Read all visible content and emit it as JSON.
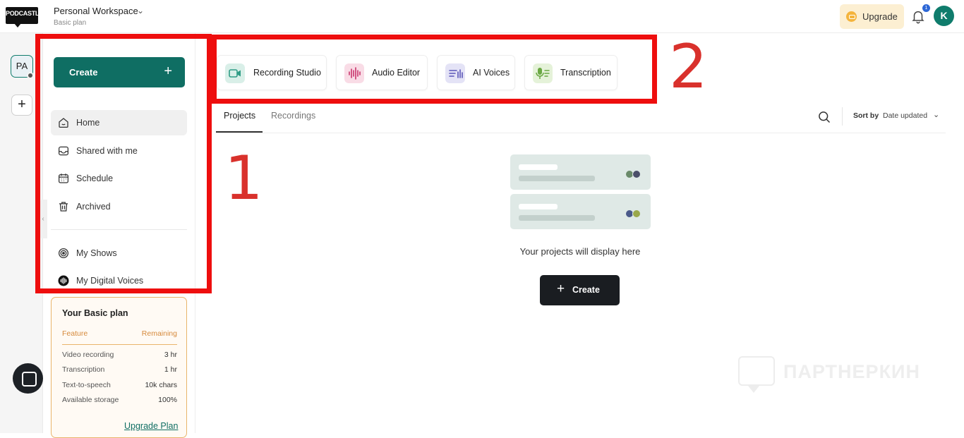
{
  "header": {
    "logo_text": "PODCASTLE",
    "workspace_name": "Personal Workspace",
    "workspace_plan": "Basic plan",
    "upgrade_label": "Upgrade",
    "notification_count": "1",
    "avatar_initial": "K"
  },
  "rail": {
    "workspace_initials": "PA",
    "add_label": "+"
  },
  "sidebar": {
    "create_label": "Create",
    "items": [
      {
        "label": "Home",
        "icon": "home-icon"
      },
      {
        "label": "Shared with me",
        "icon": "inbox-icon"
      },
      {
        "label": "Schedule",
        "icon": "calendar-icon"
      },
      {
        "label": "Archived",
        "icon": "trash-icon"
      },
      {
        "label": "My Shows",
        "icon": "podcast-icon"
      },
      {
        "label": "My Digital Voices",
        "icon": "voice-wave-icon"
      }
    ]
  },
  "plan_card": {
    "title": "Your Basic plan",
    "col_feature": "Feature",
    "col_remaining": "Remaining",
    "rows": [
      {
        "feature": "Video recording",
        "remaining": "3 hr"
      },
      {
        "feature": "Transcription",
        "remaining": "1 hr"
      },
      {
        "feature": "Text-to-speech",
        "remaining": "10k chars"
      },
      {
        "feature": "Available storage",
        "remaining": "100%"
      }
    ],
    "upgrade_link": "Upgrade Plan"
  },
  "tools": [
    {
      "label": "Recording Studio",
      "icon": "video-camera-icon",
      "color": "#d9efe8"
    },
    {
      "label": "Audio Editor",
      "icon": "waveform-icon",
      "color": "#f9dce6"
    },
    {
      "label": "AI Voices",
      "icon": "ai-voice-icon",
      "color": "#e4e3f6"
    },
    {
      "label": "Transcription",
      "icon": "microphone-text-icon",
      "color": "#e5f2d9"
    }
  ],
  "tabs": [
    {
      "label": "Projects",
      "active": true
    },
    {
      "label": "Recordings",
      "active": false
    }
  ],
  "sort": {
    "label": "Sort by",
    "value": "Date updated"
  },
  "empty_state": {
    "message": "Your projects will display here",
    "create_label": "Create"
  },
  "watermark": "ПАРТНЕРКИН",
  "annotations": [
    "1",
    "2"
  ],
  "colors": {
    "brand_green": "#0f6e63",
    "annotation_red": "#ee0e0e",
    "plan_accent": "#e9b46b"
  }
}
